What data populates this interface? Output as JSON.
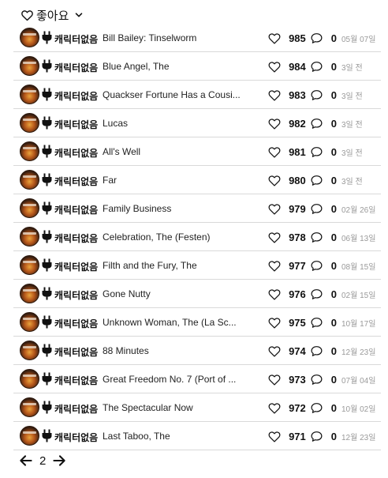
{
  "sort": {
    "label": "좋아요"
  },
  "rows": [
    {
      "author": "캐릭터없음",
      "title": "Bill Bailey: Tinselworm",
      "likes": "985",
      "comments": "0",
      "date": "05월 07일"
    },
    {
      "author": "캐릭터없음",
      "title": "Blue Angel, The",
      "likes": "984",
      "comments": "0",
      "date": "3일 전"
    },
    {
      "author": "캐릭터없음",
      "title": "Quackser Fortune Has a Cousi...",
      "likes": "983",
      "comments": "0",
      "date": "3일 전"
    },
    {
      "author": "캐릭터없음",
      "title": "Lucas",
      "likes": "982",
      "comments": "0",
      "date": "3일 전"
    },
    {
      "author": "캐릭터없음",
      "title": "All's Well",
      "likes": "981",
      "comments": "0",
      "date": "3일 전"
    },
    {
      "author": "캐릭터없음",
      "title": "Far",
      "likes": "980",
      "comments": "0",
      "date": "3일 전"
    },
    {
      "author": "캐릭터없음",
      "title": "Family Business",
      "likes": "979",
      "comments": "0",
      "date": "02월 26일"
    },
    {
      "author": "캐릭터없음",
      "title": "Celebration, The (Festen)",
      "likes": "978",
      "comments": "0",
      "date": "06월 13일"
    },
    {
      "author": "캐릭터없음",
      "title": "Filth and the Fury, The",
      "likes": "977",
      "comments": "0",
      "date": "08월 15일"
    },
    {
      "author": "캐릭터없음",
      "title": "Gone Nutty",
      "likes": "976",
      "comments": "0",
      "date": "02월 15일"
    },
    {
      "author": "캐릭터없음",
      "title": "Unknown Woman, The (La Sc...",
      "likes": "975",
      "comments": "0",
      "date": "10월 17일"
    },
    {
      "author": "캐릭터없음",
      "title": "88 Minutes",
      "likes": "974",
      "comments": "0",
      "date": "12월 23일"
    },
    {
      "author": "캐릭터없음",
      "title": "Great Freedom No. 7 (Port of ...",
      "likes": "973",
      "comments": "0",
      "date": "07월 04일"
    },
    {
      "author": "캐릭터없음",
      "title": "The Spectacular Now",
      "likes": "972",
      "comments": "0",
      "date": "10월 02일"
    },
    {
      "author": "캐릭터없음",
      "title": "Last Taboo, The",
      "likes": "971",
      "comments": "0",
      "date": "12월 23일"
    }
  ],
  "pager": {
    "page": "2"
  }
}
